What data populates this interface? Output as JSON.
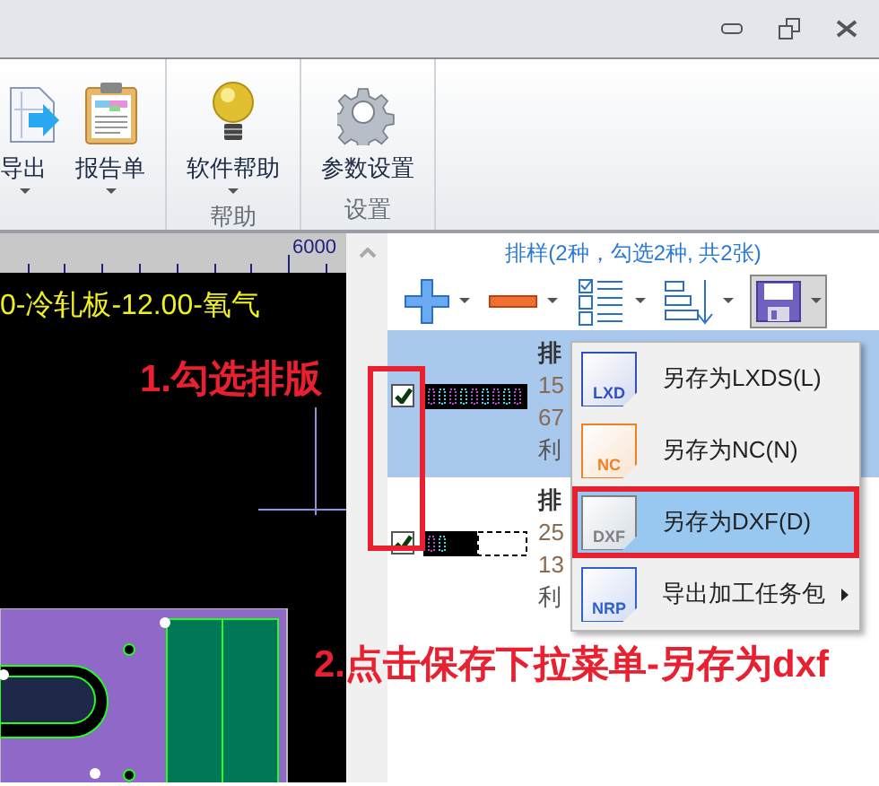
{
  "ribbon": {
    "groups": [
      {
        "buttons": [
          {
            "label": "导出",
            "kind": "export",
            "dropdown": true
          },
          {
            "label": "报告单",
            "kind": "report",
            "dropdown": true
          }
        ]
      },
      {
        "label": "帮助",
        "buttons": [
          {
            "label": "软件帮助",
            "kind": "help",
            "dropdown": true
          }
        ]
      },
      {
        "label": "设置",
        "buttons": [
          {
            "label": "参数设置",
            "kind": "settings",
            "dropdown": false
          }
        ]
      }
    ]
  },
  "canvas": {
    "ruler_label": "6000",
    "sheet_title": "0-冷轧板-12.00-氧气"
  },
  "annotations": [
    {
      "text": "1.勾选排版"
    },
    {
      "text": "2.点击保存下拉菜单-另存为dxf"
    }
  ],
  "panel": {
    "header": "排样(2种，勾选2种, 共2张)",
    "toolbar": [
      {
        "kind": "add",
        "pressed": false
      },
      {
        "kind": "remove",
        "pressed": false
      },
      {
        "kind": "checklist",
        "pressed": false
      },
      {
        "kind": "sort",
        "pressed": false
      },
      {
        "kind": "save",
        "pressed": true
      }
    ],
    "rows": [
      {
        "title": "排",
        "lines": [
          "15",
          "67",
          "利"
        ],
        "checked": true,
        "selected": true
      },
      {
        "title": "排",
        "lines": [
          "25",
          "13",
          "利"
        ],
        "checked": true,
        "selected": false
      }
    ]
  },
  "menu": [
    {
      "label": "另存为LXDS(L)",
      "icon_text": "LXD",
      "selected": false,
      "submenu": false
    },
    {
      "label": "另存为NC(N)",
      "icon_text": "NC",
      "selected": false,
      "submenu": false
    },
    {
      "label": "另存为DXF(D)",
      "icon_text": "DXF",
      "selected": true,
      "submenu": false
    },
    {
      "label": "导出加工任务包",
      "icon_text": "NRP",
      "selected": false,
      "submenu": true
    }
  ]
}
